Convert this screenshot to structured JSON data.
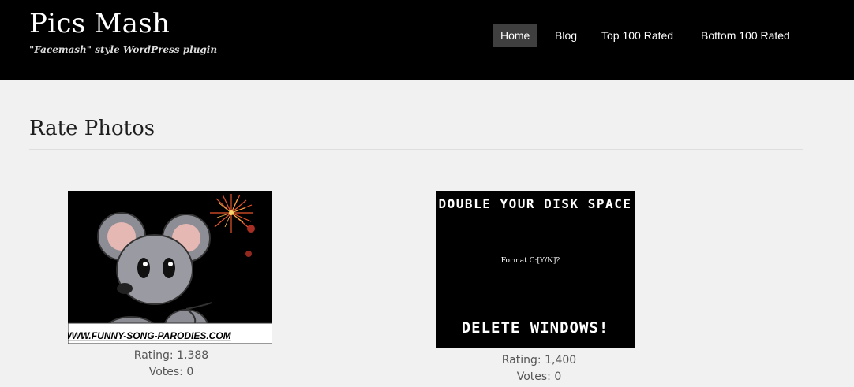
{
  "header": {
    "site_title": "Pics Mash",
    "tagline": "\"Facemash\" style WordPress plugin"
  },
  "nav": {
    "items": [
      {
        "label": "Home",
        "active": true
      },
      {
        "label": "Blog",
        "active": false
      },
      {
        "label": "Top 100 Rated",
        "active": false
      },
      {
        "label": "Bottom 100 Rated",
        "active": false
      }
    ]
  },
  "main": {
    "page_title": "Rate Photos",
    "photos": [
      {
        "banner_text": "WWW.FUNNY-SONG-PARODIES.COM",
        "rating": "Rating: 1,388",
        "votes": "Votes: 0"
      },
      {
        "headline": "DOUBLE YOUR DISK SPACE",
        "prompt": "Format C:[Y/N]?",
        "footer": "DELETE WINDOWS!",
        "rating": "Rating: 1,400",
        "votes": "Votes: 0"
      }
    ]
  },
  "colors": {
    "header_bg": "#000000",
    "page_bg": "#f1f1f1",
    "nav_active_bg": "#3f3f3f"
  }
}
